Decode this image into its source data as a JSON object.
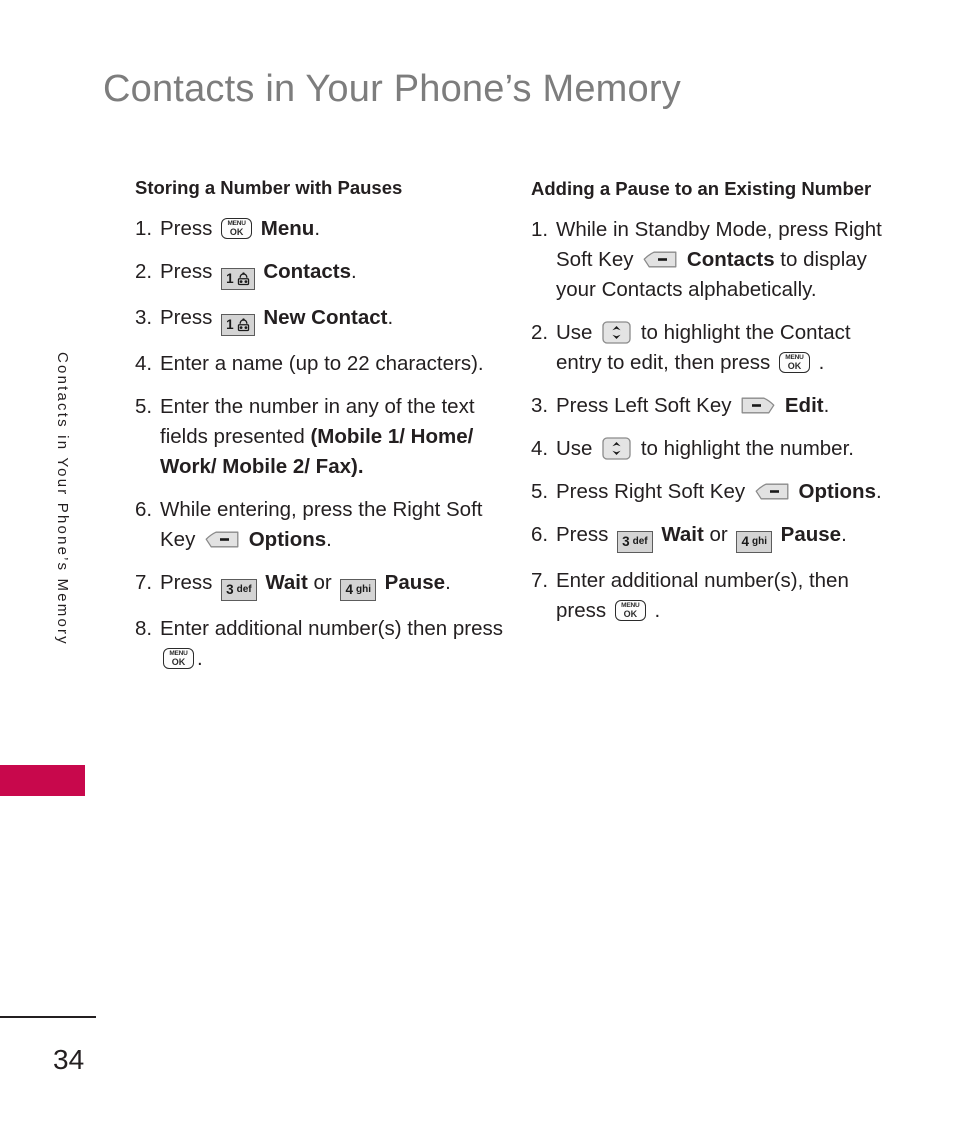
{
  "page": {
    "title": "Contacts in Your Phone’s Memory",
    "side_tab_label": "Contacts in Your Phone’s Memory",
    "side_tab_color": "#c8084c",
    "page_number": "34",
    "title_color": "#7d7d7d",
    "text_color": "#231f20"
  },
  "icons": {
    "menu_ok": {
      "name": "menu-ok-key-icon",
      "line1": "MENU",
      "line2": "OK"
    },
    "key_1": {
      "name": "keypad-1-voicemail-key-icon",
      "digit": "1",
      "letters": ""
    },
    "key_3": {
      "name": "keypad-3-key-icon",
      "digit": "3",
      "letters": "def"
    },
    "key_4": {
      "name": "keypad-4-key-icon",
      "digit": "4",
      "letters": "ghi"
    },
    "right_soft_key": {
      "name": "right-soft-key-icon"
    },
    "left_soft_key": {
      "name": "left-soft-key-icon"
    },
    "nav_updown": {
      "name": "navigation-up-down-key-icon"
    }
  },
  "left_column": {
    "heading": "Storing a Number with Pauses",
    "steps": [
      {
        "num": "1.",
        "parts": [
          {
            "t": "text",
            "v": "Press "
          },
          {
            "t": "icon",
            "v": "menu_ok"
          },
          {
            "t": "bold",
            "v": " Menu"
          },
          {
            "t": "text",
            "v": "."
          }
        ]
      },
      {
        "num": "2.",
        "parts": [
          {
            "t": "text",
            "v": "Press "
          },
          {
            "t": "icon",
            "v": "key_1"
          },
          {
            "t": "bold",
            "v": " Contacts"
          },
          {
            "t": "text",
            "v": "."
          }
        ]
      },
      {
        "num": "3.",
        "parts": [
          {
            "t": "text",
            "v": "Press "
          },
          {
            "t": "icon",
            "v": "key_1"
          },
          {
            "t": "bold",
            "v": " New Contact"
          },
          {
            "t": "text",
            "v": "."
          }
        ]
      },
      {
        "num": "4.",
        "parts": [
          {
            "t": "text",
            "v": "Enter a name (up to 22 characters)."
          }
        ]
      },
      {
        "num": "5.",
        "parts": [
          {
            "t": "text",
            "v": "Enter the number in any of the text fields presented "
          },
          {
            "t": "bold",
            "v": "(Mobile 1/ Home/ Work/ Mobile 2/ Fax)."
          }
        ]
      },
      {
        "num": "6.",
        "parts": [
          {
            "t": "text",
            "v": "While entering, press the Right Soft Key "
          },
          {
            "t": "icon",
            "v": "right_soft_key"
          },
          {
            "t": "bold",
            "v": " Options"
          },
          {
            "t": "text",
            "v": "."
          }
        ]
      },
      {
        "num": "7.",
        "parts": [
          {
            "t": "text",
            "v": "Press "
          },
          {
            "t": "icon",
            "v": "key_3"
          },
          {
            "t": "bold",
            "v": " Wait "
          },
          {
            "t": "text",
            "v": "or "
          },
          {
            "t": "icon",
            "v": "key_4"
          },
          {
            "t": "bold",
            "v": " Pause"
          },
          {
            "t": "text",
            "v": "."
          }
        ]
      },
      {
        "num": "8.",
        "parts": [
          {
            "t": "text",
            "v": "Enter additional number(s) then press "
          },
          {
            "t": "icon",
            "v": "menu_ok"
          },
          {
            "t": "text",
            "v": "."
          }
        ]
      }
    ]
  },
  "right_column": {
    "heading": "Adding a Pause to an Existing Number",
    "steps": [
      {
        "num": "1.",
        "parts": [
          {
            "t": "text",
            "v": "While in Standby Mode, press Right Soft Key "
          },
          {
            "t": "icon",
            "v": "right_soft_key"
          },
          {
            "t": "bold",
            "v": " Contacts"
          },
          {
            "t": "text",
            "v": " to display your Contacts alphabetically."
          }
        ]
      },
      {
        "num": "2.",
        "parts": [
          {
            "t": "text",
            "v": "Use "
          },
          {
            "t": "icon",
            "v": "nav_updown"
          },
          {
            "t": "text",
            "v": " to highlight the Contact entry to edit, then press "
          },
          {
            "t": "icon",
            "v": "menu_ok"
          },
          {
            "t": "text",
            "v": " ."
          }
        ]
      },
      {
        "num": "3.",
        "parts": [
          {
            "t": "text",
            "v": "Press Left Soft Key "
          },
          {
            "t": "icon",
            "v": "left_soft_key"
          },
          {
            "t": "bold",
            "v": " Edit"
          },
          {
            "t": "text",
            "v": "."
          }
        ]
      },
      {
        "num": "4.",
        "parts": [
          {
            "t": "text",
            "v": "Use "
          },
          {
            "t": "icon",
            "v": "nav_updown"
          },
          {
            "t": "text",
            "v": " to highlight the number."
          }
        ]
      },
      {
        "num": "5.",
        "parts": [
          {
            "t": "text",
            "v": "Press Right Soft Key "
          },
          {
            "t": "icon",
            "v": "right_soft_key"
          },
          {
            "t": "bold",
            "v": " Options"
          },
          {
            "t": "text",
            "v": "."
          }
        ]
      },
      {
        "num": "6.",
        "parts": [
          {
            "t": "text",
            "v": "Press "
          },
          {
            "t": "icon",
            "v": "key_3"
          },
          {
            "t": "bold",
            "v": " Wait "
          },
          {
            "t": "text",
            "v": "or "
          },
          {
            "t": "icon",
            "v": "key_4"
          },
          {
            "t": "bold",
            "v": " Pause"
          },
          {
            "t": "text",
            "v": "."
          }
        ]
      },
      {
        "num": "7.",
        "parts": [
          {
            "t": "text",
            "v": "Enter additional number(s), then press "
          },
          {
            "t": "icon",
            "v": "menu_ok"
          },
          {
            "t": "text",
            "v": " ."
          }
        ]
      }
    ]
  }
}
